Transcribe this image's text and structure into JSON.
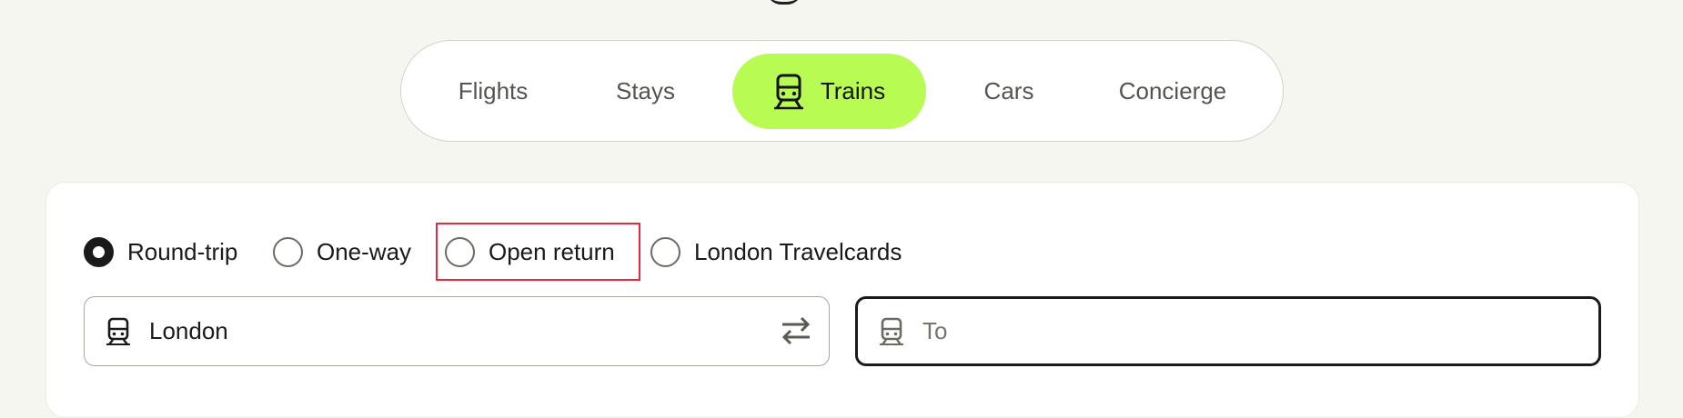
{
  "tabs": [
    {
      "label": "Flights",
      "icon": "plane-icon",
      "active": false
    },
    {
      "label": "Stays",
      "icon": "bed-icon",
      "active": false
    },
    {
      "label": "Trains",
      "icon": "train-icon",
      "active": true
    },
    {
      "label": "Cars",
      "icon": "car-icon",
      "active": false
    },
    {
      "label": "Concierge",
      "icon": "concierge-icon",
      "active": false
    }
  ],
  "trip_types": [
    {
      "label": "Round-trip",
      "checked": true
    },
    {
      "label": "One-way",
      "checked": false
    },
    {
      "label": "Open return",
      "checked": false,
      "highlighted": true
    },
    {
      "label": "London Travelcards",
      "checked": false
    }
  ],
  "from_field": {
    "value": "London",
    "icon": "train-icon",
    "action_icon": "swap-arrows-icon"
  },
  "to_field": {
    "value": "",
    "placeholder": "To",
    "icon": "train-icon"
  },
  "colors": {
    "page_background": "#f6f6f0",
    "active_tab": "#b8fb53",
    "highlight_outline": "#e8283f",
    "text_primary": "#1a1a1a",
    "text_muted": "#55554f"
  }
}
